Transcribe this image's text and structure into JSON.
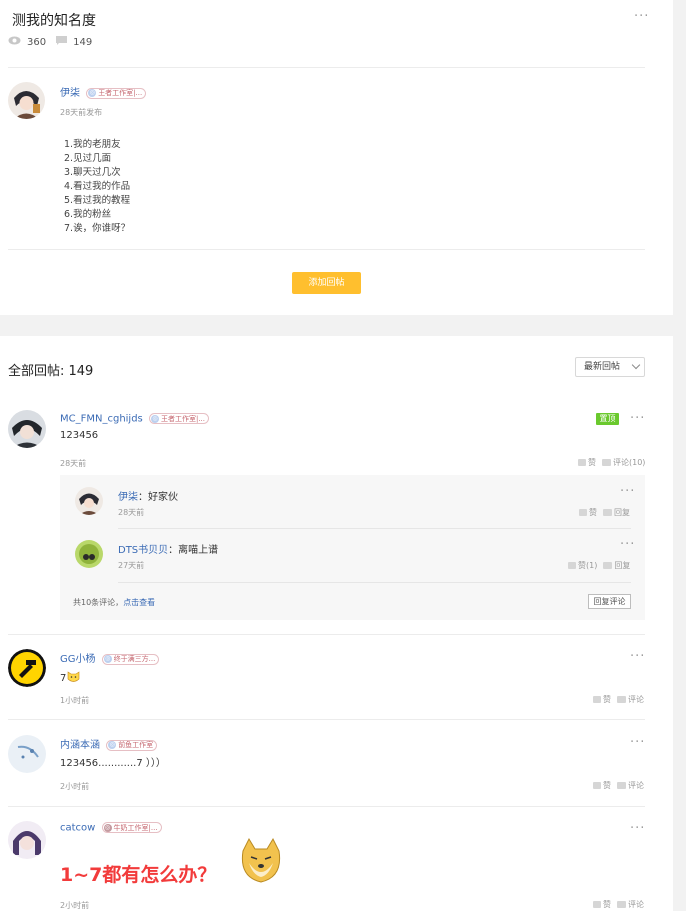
{
  "topic": {
    "title": "测我的知名度",
    "views": "360",
    "comments": "149",
    "author": {
      "name": "伊柒",
      "badge": "王者工作室|...",
      "time": "28天前发布"
    },
    "content": [
      "1.我的老朋友",
      "2.见过几面",
      "3.聊天过几次",
      "4.看过我的作品",
      "5.看过我的教程",
      "6.我的粉丝",
      "7.诶，你谁呀？"
    ],
    "add_reply_label": "添加回帖"
  },
  "replies_header": {
    "title": "全部回帖: 149",
    "sort_label": "最新回帖"
  },
  "labels": {
    "like": "赞",
    "comment": "评论",
    "reply": "回复"
  },
  "replies": [
    {
      "name": "MC_FMN_cghijds",
      "badge": "王者工作室|...",
      "text": "123456",
      "time": "28天前",
      "pinned": "置顶",
      "comment_count": "评论(10)",
      "sub_replies": [
        {
          "name": "伊柒",
          "text": "：好家伙",
          "time": "28天前"
        },
        {
          "name": "DTS书贝贝",
          "text": "：离喵上谱",
          "time": "27天前",
          "likes": "赞(1)"
        }
      ],
      "footer_text": "共10条评论，",
      "footer_link": "点击查看",
      "reply_comment_label": "回复评论"
    },
    {
      "name": "GG小杨",
      "badge": "终于满三方...",
      "text": "7",
      "time": "1小时前"
    },
    {
      "name": "内涵本涵",
      "badge": "前鱼工作室",
      "text": "123456............7 ）））",
      "time": "2小时前"
    },
    {
      "name": "catcow",
      "badge": "牛奶工作室|...",
      "text": "1~7都有怎么办？",
      "time": "2小时前"
    }
  ],
  "colors": {
    "accent": "#ffbf2e",
    "link": "#3b6bb5",
    "pin": "#6ac92d",
    "highlight_red": "#f23b3b"
  },
  "icons": [
    "eye-icon",
    "comment-icon",
    "more-icon",
    "thumb-up-icon",
    "chevron-down-icon",
    "cat-emoji-icon",
    "doge-icon"
  ]
}
